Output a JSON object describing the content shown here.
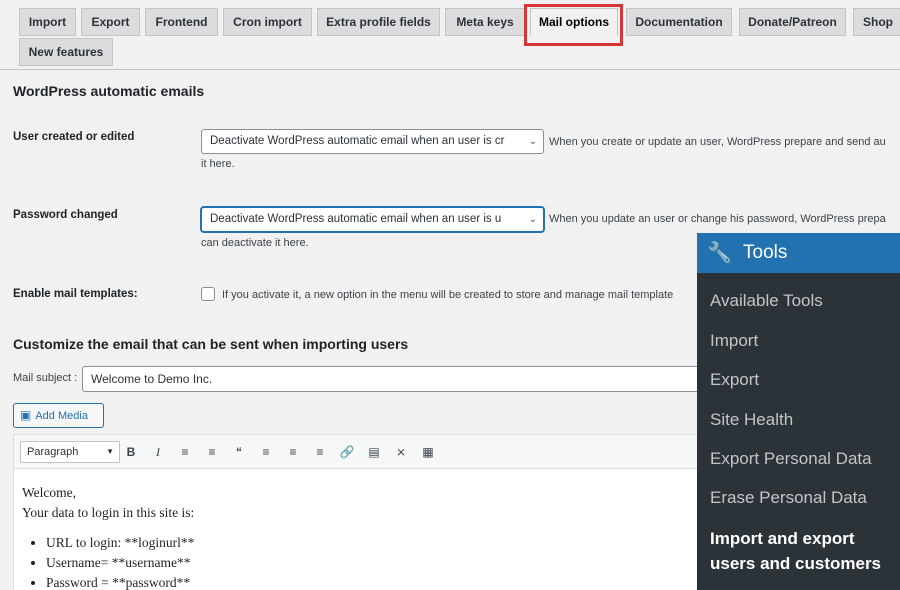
{
  "tabs": [
    {
      "label": "Import"
    },
    {
      "label": "Export"
    },
    {
      "label": "Frontend"
    },
    {
      "label": "Cron import"
    },
    {
      "label": "Extra profile fields"
    },
    {
      "label": "Meta keys"
    },
    {
      "label": "Mail options"
    },
    {
      "label": "Documentation"
    },
    {
      "label": "Donate/Patreon"
    },
    {
      "label": "Shop"
    },
    {
      "label": "New features"
    }
  ],
  "active_tab": "Mail options",
  "highlight_color": "#d63638",
  "section1": {
    "title": "WordPress automatic emails",
    "user_created": {
      "label": "User created or edited",
      "select_value": "Deactivate WordPress automatic email when an user is cr",
      "desc_line1": "When you create or update an user, WordPress prepare and send au",
      "desc_line2": "it here."
    },
    "password_changed": {
      "label": "Password changed",
      "select_value": "Deactivate WordPress automatic email when an user is u",
      "desc_line1": "When you update an user or change his password, WordPress prepa",
      "desc_line2": "can deactivate it here."
    },
    "mail_templates": {
      "label": "Enable mail templates:",
      "desc": "If you activate it, a new option in the menu will be created to store and manage mail template"
    }
  },
  "section2": {
    "title": "Customize the email that can be sent when importing users",
    "subject_label": "Mail subject :",
    "subject_value": "Welcome to Demo Inc.",
    "add_media_label": "Add Media",
    "format_value": "Paragraph",
    "toolbar_icons": [
      "bold-icon",
      "italic-icon",
      "bullet-list-icon",
      "numbered-list-icon",
      "blockquote-icon",
      "align-left-icon",
      "align-center-icon",
      "align-right-icon",
      "link-icon",
      "read-more-icon",
      "fullscreen-icon",
      "toolbar-toggle-icon"
    ],
    "body": {
      "line1": "Welcome,",
      "line2": "Your data to login in this site is:",
      "items": [
        "URL to login: **loginurl**",
        "Username= **username**",
        "Password = **password**"
      ]
    }
  },
  "tools_menu": {
    "title": "Tools",
    "items": [
      "Available Tools",
      "Import",
      "Export",
      "Site Health",
      "Export Personal Data",
      "Erase Personal Data"
    ],
    "current_line1": "Import and export",
    "current_line2": "users and customers"
  },
  "colors": {
    "wp_blue": "#2271b1",
    "admin_dark": "#2c3338"
  }
}
